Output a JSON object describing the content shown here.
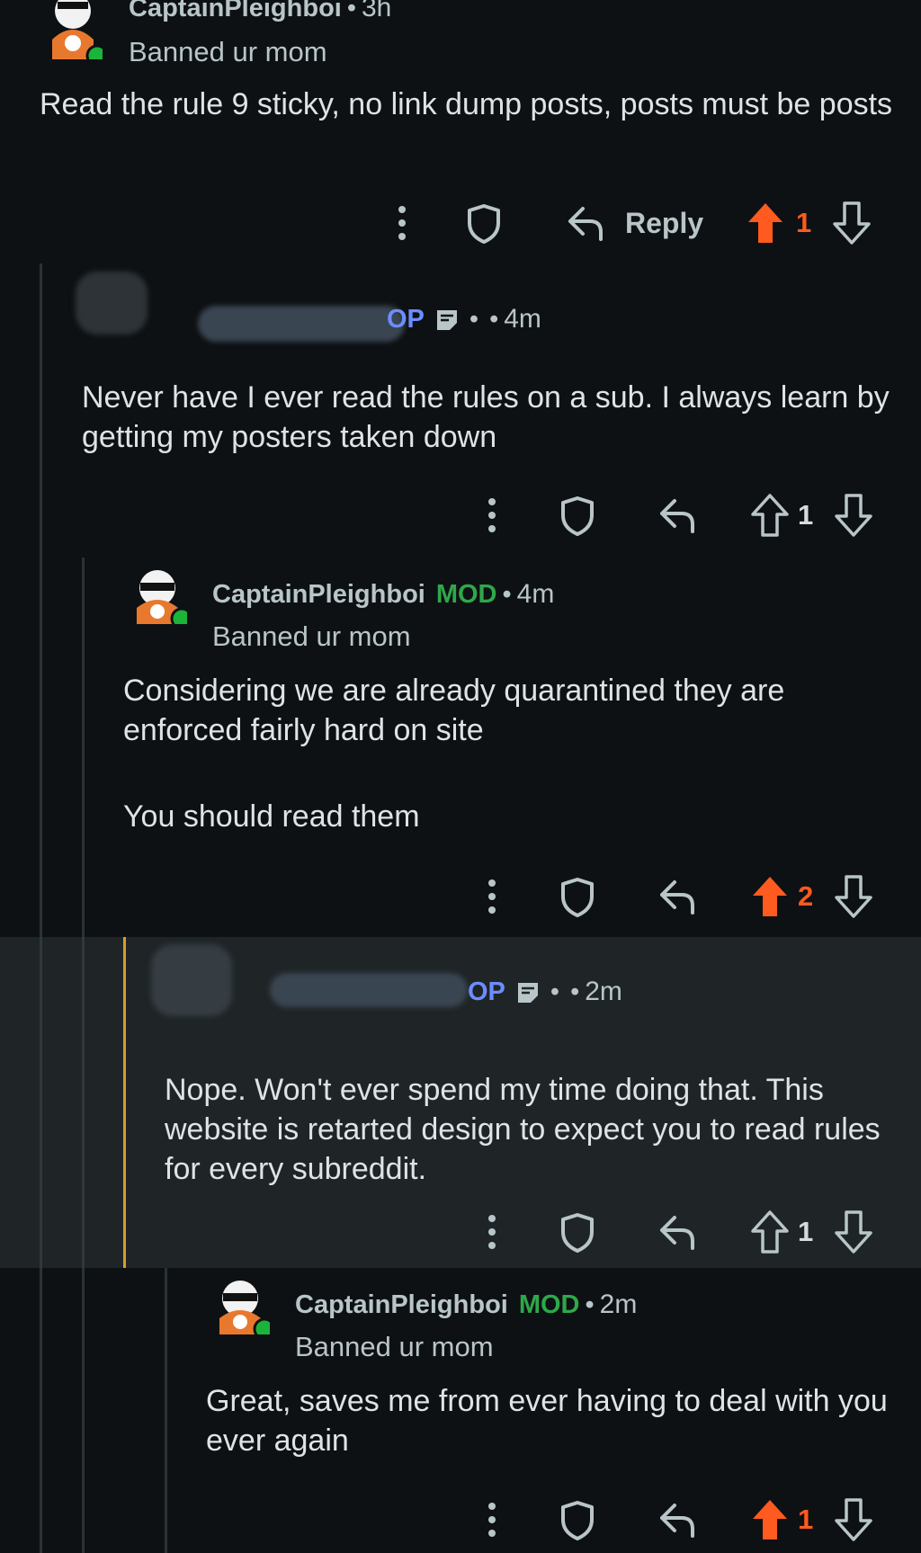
{
  "comments": [
    {
      "author": "CaptainPleighboi",
      "time": "3h",
      "flair": "Banned ur mom",
      "body": [
        "Read the rule 9 sticky, no link dump posts, posts must be posts"
      ],
      "reply_label": "Reply",
      "votes": "1"
    },
    {
      "op_tag": "OP",
      "time": "4m",
      "body": [
        "Never have I ever read the rules on a sub. I always learn by getting my posters taken down"
      ],
      "votes": "1"
    },
    {
      "author": "CaptainPleighboi",
      "mod_tag": "MOD",
      "time": "4m",
      "flair": "Banned ur mom",
      "body": [
        "Considering we are already quarantined they are enforced fairly hard on site",
        "You should read them"
      ],
      "votes": "2"
    },
    {
      "op_tag": "OP",
      "time": "2m",
      "body": [
        "Nope. Won't ever spend my time doing that. This website is retarted design to expect you to read rules for every subreddit."
      ],
      "votes": "1"
    },
    {
      "author": "CaptainPleighboi",
      "mod_tag": "MOD",
      "time": "2m",
      "flair": "Banned ur mom",
      "body": [
        "Great, saves me from ever having to deal with you ever again"
      ],
      "votes": "1"
    }
  ],
  "colors": {
    "background": "#0e1113",
    "highlight": "#1f2527",
    "upvote": "#ff5a1f",
    "mod": "#2ea84a",
    "op": "#6d8dff",
    "highlight_bar": "#d99c27"
  },
  "icons": [
    "snoo-avatar-icon",
    "more-options-icon",
    "shield-icon",
    "reply-arrow-icon",
    "upvote-arrow-icon",
    "downvote-arrow-icon",
    "note-icon"
  ]
}
